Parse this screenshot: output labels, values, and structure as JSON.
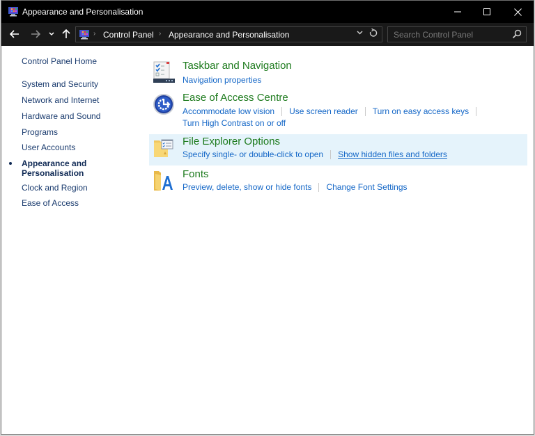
{
  "window": {
    "title": "Appearance and Personalisation",
    "controls": {
      "minimize": "minimize",
      "maximize": "maximize",
      "close": "close"
    }
  },
  "navigation": {
    "back_icon": "arrow-left-icon",
    "forward_icon": "arrow-right-icon",
    "recent_icon": "chevron-down-icon",
    "up_icon": "arrow-up-icon",
    "breadcrumbs": [
      "Control Panel",
      "Appearance and Personalisation"
    ],
    "search": {
      "placeholder": "Search Control Panel",
      "value": ""
    }
  },
  "sidebar": {
    "home": "Control Panel Home",
    "items": [
      {
        "label": "System and Security",
        "active": false
      },
      {
        "label": "Network and Internet",
        "active": false
      },
      {
        "label": "Hardware and Sound",
        "active": false
      },
      {
        "label": "Programs",
        "active": false
      },
      {
        "label": "User Accounts",
        "active": false
      },
      {
        "label": "Appearance and Personalisation",
        "label_line1": "Appearance and",
        "label_line2": "Personalisation",
        "active": true
      },
      {
        "label": "Clock and Region",
        "active": false
      },
      {
        "label": "Ease of Access",
        "active": false
      }
    ]
  },
  "categories": [
    {
      "title": "Taskbar and Navigation",
      "icon": "taskbar-icon",
      "links": [
        "Navigation properties"
      ]
    },
    {
      "title": "Ease of Access Centre",
      "icon": "ease-of-access-icon",
      "links": [
        "Accommodate low vision",
        "Use screen reader",
        "Turn on easy access keys",
        "Turn High Contrast on or off"
      ]
    },
    {
      "title": "File Explorer Options",
      "icon": "folder-options-icon",
      "highlighted": true,
      "links": [
        "Specify single- or double-click to open",
        "Show hidden files and folders"
      ]
    },
    {
      "title": "Fonts",
      "icon": "fonts-folder-icon",
      "links": [
        "Preview, delete, show or hide fonts",
        "Change Font Settings"
      ]
    }
  ],
  "colors": {
    "title_bar": "#000000",
    "nav_bar": "#191919",
    "category_title": "#1e7b1e",
    "link": "#1467c7",
    "sidebar_link": "#1a3b6e",
    "hover_bg": "#e5f3fb"
  }
}
